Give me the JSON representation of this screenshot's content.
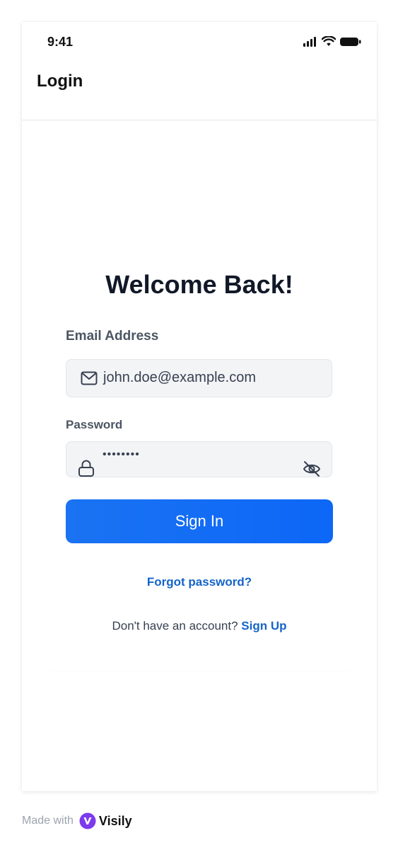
{
  "status_bar": {
    "time": "9:41"
  },
  "header": {
    "title": "Login"
  },
  "form": {
    "heading": "Welcome Back!",
    "email": {
      "label": "Email Address",
      "value": "john.doe@example.com"
    },
    "password": {
      "label": "Password",
      "value": "••••••••"
    },
    "signin_label": "Sign In",
    "forgot_label": "Forgot password?",
    "signup_prompt": "Don't have an account? ",
    "signup_link": "Sign Up"
  },
  "footer": {
    "made_with": "Made with",
    "brand": "Visily"
  },
  "colors": {
    "primary": "#0D6EFD",
    "link": "#1464C8",
    "input_bg": "#F3F4F6",
    "brand_purple": "#7C3AED"
  },
  "icons": {
    "status": [
      "signal-icon",
      "wifi-icon",
      "battery-icon"
    ],
    "email_field": "mail-icon",
    "password_field": "lock-icon",
    "password_toggle": "eye-off-icon",
    "brand": "visily-logo-icon"
  }
}
